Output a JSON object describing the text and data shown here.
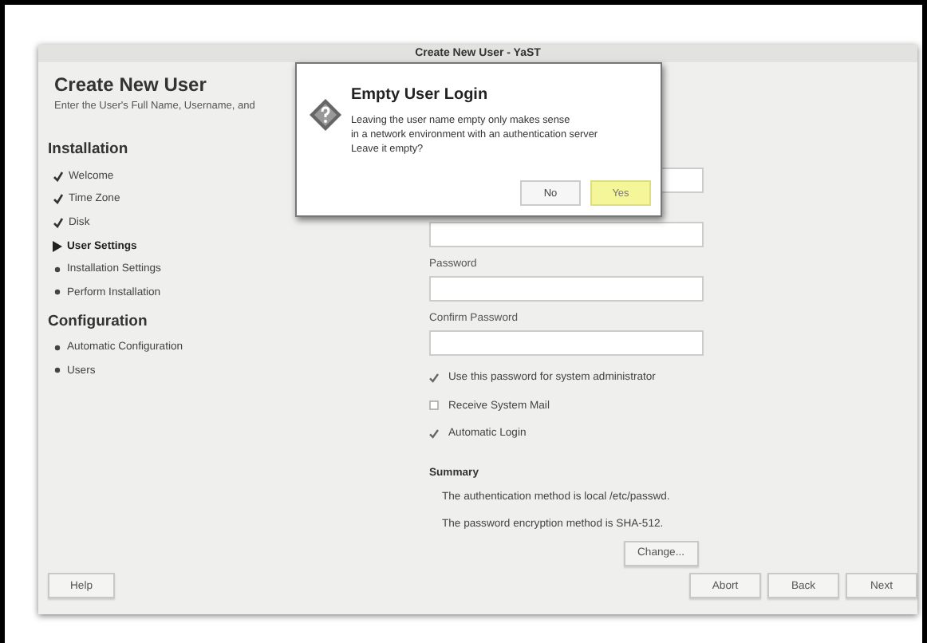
{
  "window": {
    "title": "Create New User - YaST"
  },
  "header": {
    "title": "Create New User",
    "subtitle": "Enter the User's Full Name, Username, and"
  },
  "sidebar": {
    "sections": [
      {
        "heading": "Installation",
        "items": [
          {
            "label": "Welcome",
            "kind": "done"
          },
          {
            "label": "Time Zone",
            "kind": "done"
          },
          {
            "label": "Disk",
            "kind": "done"
          },
          {
            "label": "User Settings",
            "kind": "current"
          },
          {
            "label": "Installation Settings",
            "kind": "pending"
          },
          {
            "label": "Perform Installation",
            "kind": "pending"
          }
        ]
      },
      {
        "heading": "Configuration",
        "items": [
          {
            "label": "Automatic Configuration",
            "kind": "pending"
          },
          {
            "label": "Users",
            "kind": "pending"
          }
        ]
      }
    ]
  },
  "form": {
    "items": [
      {
        "kind": "field"
      },
      {
        "kind": "field"
      },
      {
        "kind": "field",
        "label": "Password"
      },
      {
        "kind": "field",
        "label": "Confirm Password"
      },
      {
        "kind": "checkbox",
        "label": "Use this password for system administrator",
        "checked": true
      },
      {
        "kind": "checkbox",
        "label": "Receive System Mail",
        "checked": false
      },
      {
        "kind": "checkbox",
        "label": "Automatic Login",
        "checked": true
      }
    ]
  },
  "summary": {
    "heading": "Summary",
    "lines": [
      "The authentication method is local /etc/passwd.",
      "The password encryption method is SHA-512."
    ],
    "button": "Change..."
  },
  "buttons": {
    "help": "Help",
    "actions": [
      "Abort",
      "Back",
      "Next"
    ]
  },
  "dialog": {
    "title": "Empty User Login",
    "lines": [
      "Leaving the user name empty only makes sense",
      "in a network environment with an authentication server",
      "Leave it empty?"
    ],
    "buttons": [
      {
        "label": "No",
        "selected": false
      },
      {
        "label": "Yes",
        "selected": true
      }
    ]
  }
}
